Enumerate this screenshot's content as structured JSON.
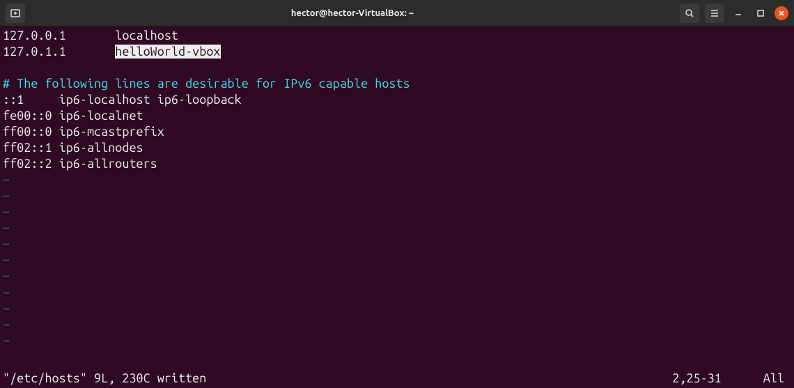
{
  "titlebar": {
    "title": "hector@hector-VirtualBox: ~"
  },
  "file": {
    "lines": [
      {
        "type": "plain",
        "parts": [
          {
            "text": "127.0.0.1       localhost"
          }
        ]
      },
      {
        "type": "plain",
        "parts": [
          {
            "text": "127.0.1.1       "
          },
          {
            "text": "helloWorld-vbo",
            "cls": "cursor"
          },
          {
            "text": "x",
            "cls": "cursor"
          }
        ]
      },
      {
        "type": "blank"
      },
      {
        "type": "comment",
        "parts": [
          {
            "text": "# The following lines are desirable for IPv6 capable hosts"
          }
        ]
      },
      {
        "type": "plain",
        "parts": [
          {
            "text": "::1     ip6-localhost ip6-loopback"
          }
        ]
      },
      {
        "type": "plain",
        "parts": [
          {
            "text": "fe00::0 ip6-localnet"
          }
        ]
      },
      {
        "type": "plain",
        "parts": [
          {
            "text": "ff00::0 ip6-mcastprefix"
          }
        ]
      },
      {
        "type": "plain",
        "parts": [
          {
            "text": "ff02::1 ip6-allnodes"
          }
        ]
      },
      {
        "type": "plain",
        "parts": [
          {
            "text": "ff02::2 ip6-allrouters"
          }
        ]
      }
    ],
    "tilde_count": 11
  },
  "statusline": {
    "left": "\"/etc/hosts\" 9L, 230C written",
    "position": "2,25-31",
    "scroll": "All"
  }
}
